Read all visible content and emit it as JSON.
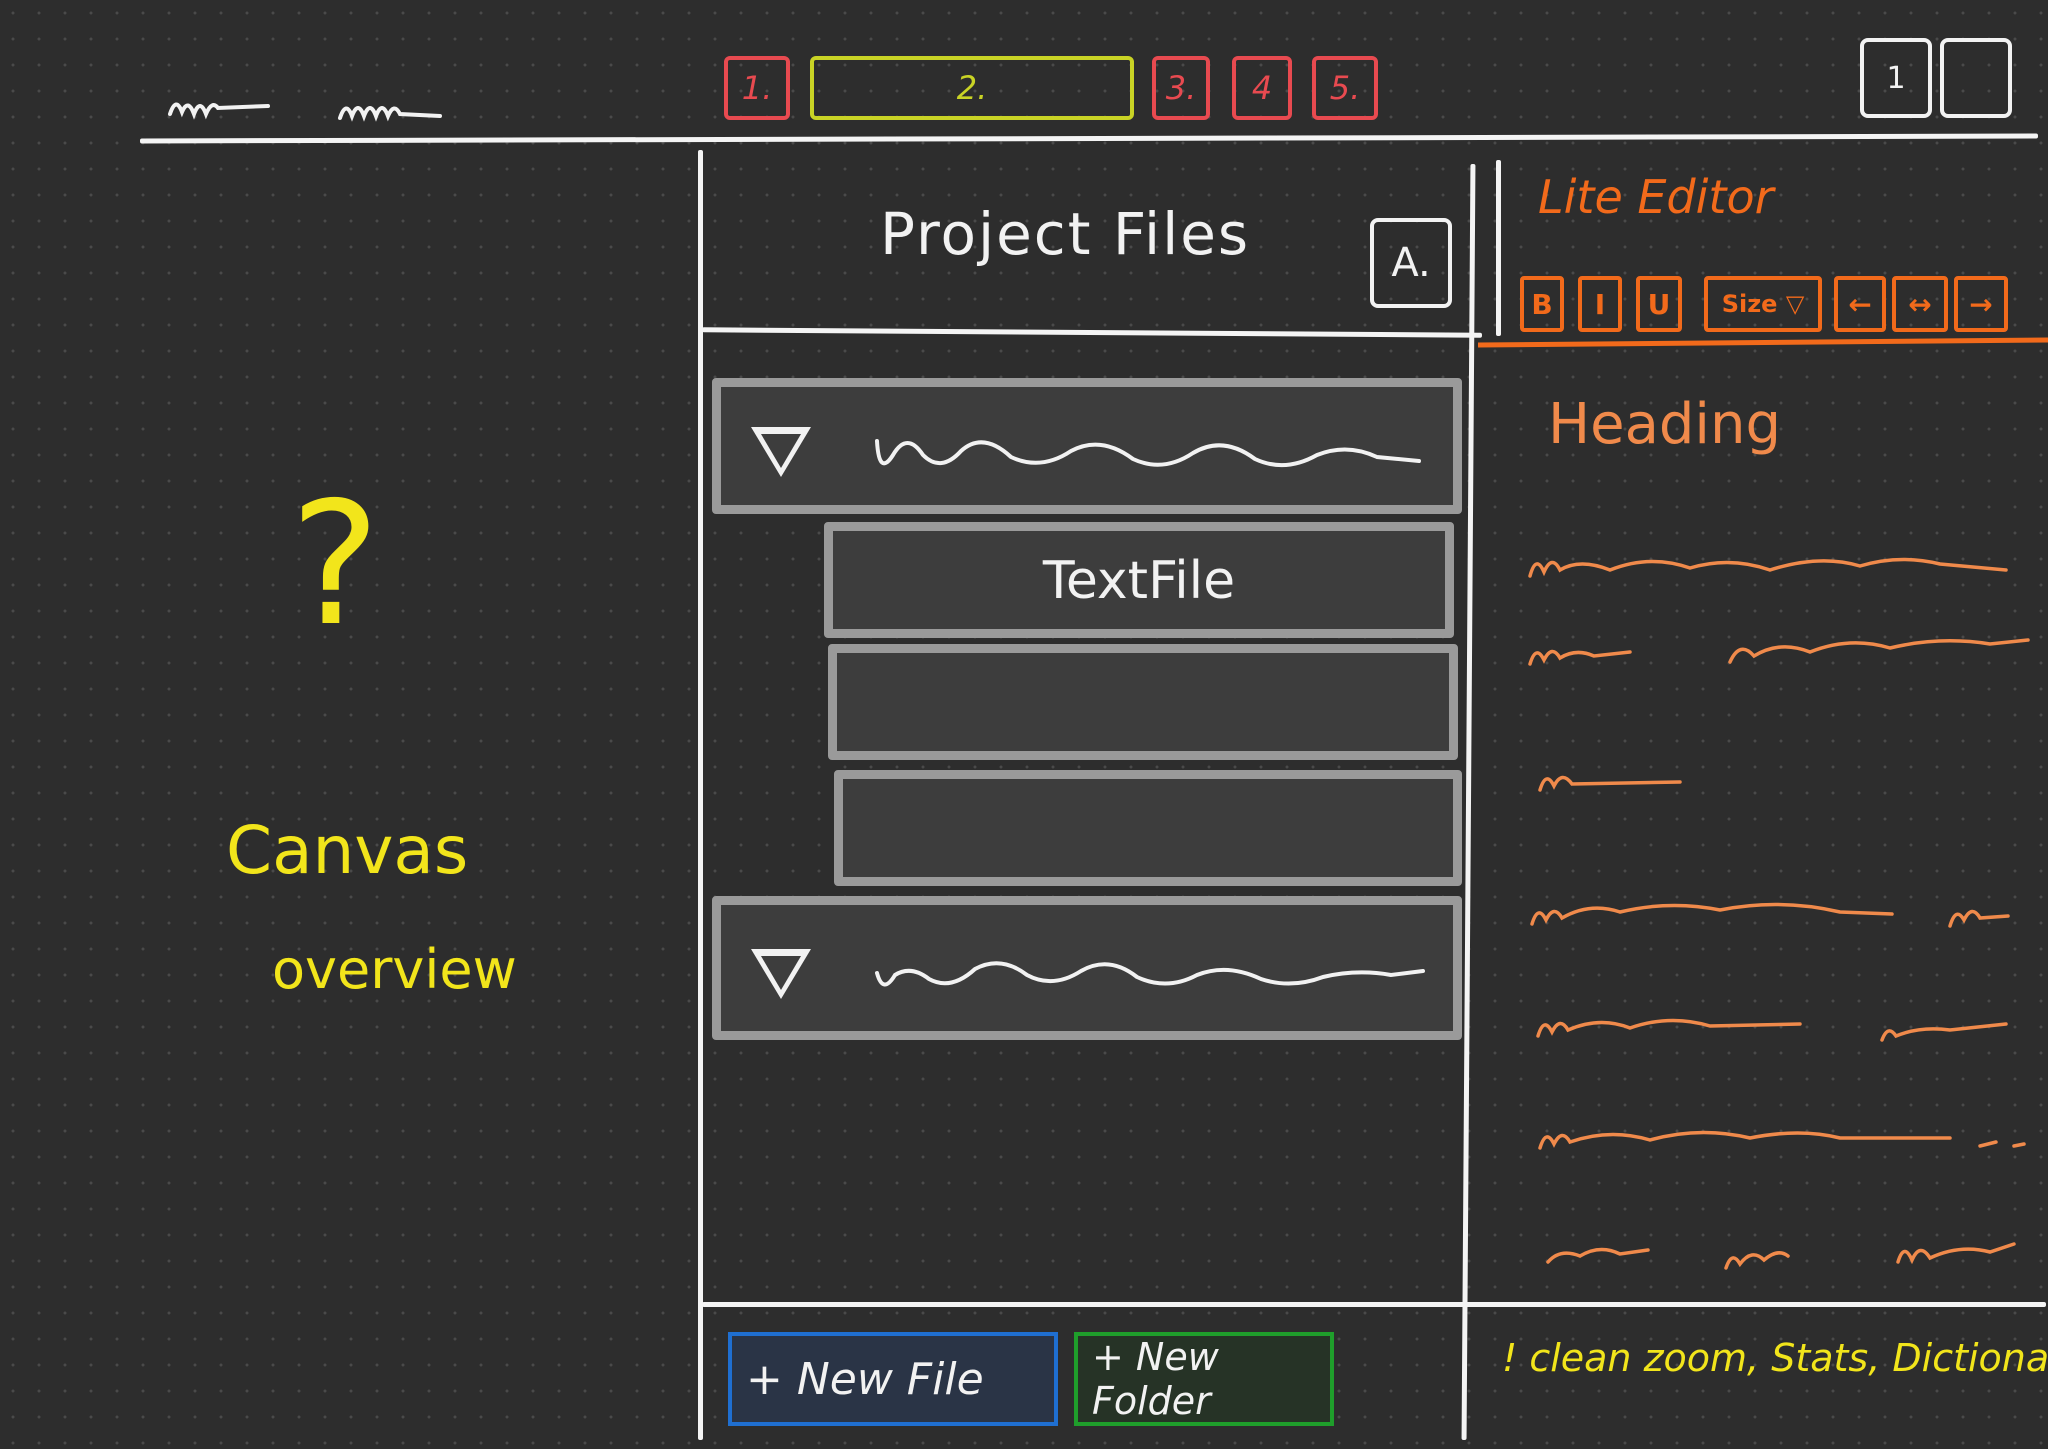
{
  "colors": {
    "background": "#2d2d2d",
    "ink": "#f2f2f2",
    "tab_inactive": "#e84a50",
    "tab_active": "#c9d325",
    "editor_accent": "#f26a1b",
    "editor_text": "#f08a4b",
    "annotation": "#f2e51b",
    "new_file_border": "#1f6fd1",
    "new_folder_border": "#1f9e2b",
    "tree_border": "#9a9a9a"
  },
  "tabs": [
    {
      "label": "1.",
      "active": false
    },
    {
      "label": "2.",
      "active": true
    },
    {
      "label": "3.",
      "active": false
    },
    {
      "label": "4",
      "active": false
    },
    {
      "label": "5.",
      "active": false
    }
  ],
  "window_buttons": [
    {
      "icon": "window-button-1-icon",
      "label": "1"
    },
    {
      "icon": "window-button-2-icon",
      "label": ""
    }
  ],
  "file_panel": {
    "title": "Project Files",
    "action_label": "A.",
    "tree": {
      "folder_1": {
        "expanded": true,
        "icon": "triangle-down-icon"
      },
      "files": [
        "TextFile",
        "",
        ""
      ],
      "folder_2": {
        "expanded": true,
        "icon": "triangle-down-icon"
      }
    },
    "new_file_label": "+ New File",
    "new_folder_label": "+ New Folder"
  },
  "editor": {
    "title": "Lite Editor",
    "toolbar": {
      "bold": "B",
      "italic": "I",
      "underline": "U",
      "size": "Size ▽",
      "align_left": "←",
      "align_center": "↔",
      "align_right": "→"
    },
    "heading": "Heading",
    "note": "! clean zoom, Stats, Dictionary."
  },
  "canvas": {
    "question_mark": "?",
    "line1": "Canvas",
    "line2": "overview"
  }
}
